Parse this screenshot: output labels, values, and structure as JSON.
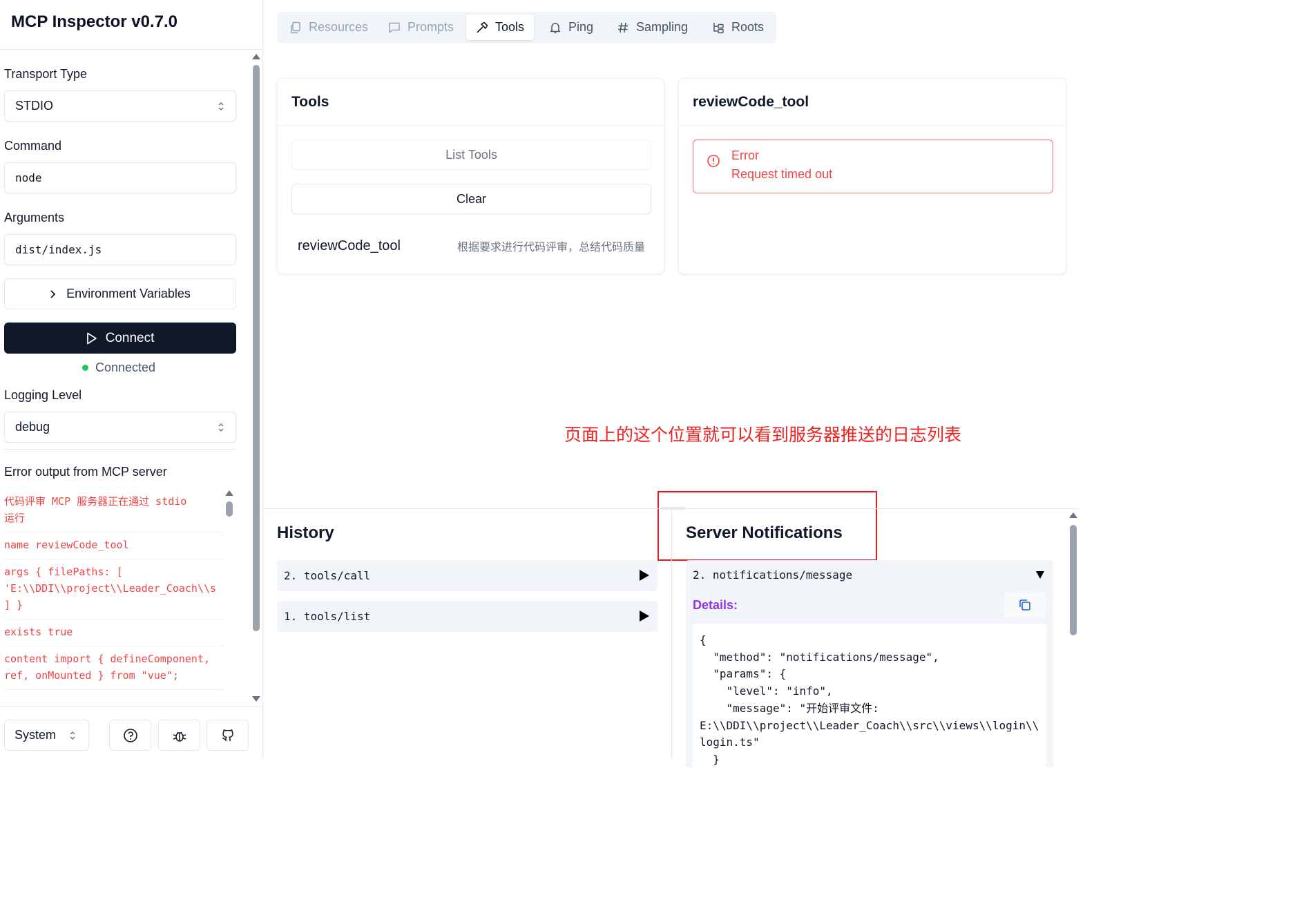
{
  "sidebar": {
    "app_title": "MCP Inspector v0.7.0",
    "transport": {
      "label": "Transport Type",
      "value": "STDIO"
    },
    "command": {
      "label": "Command",
      "value": "node"
    },
    "arguments": {
      "label": "Arguments",
      "value": "dist/index.js"
    },
    "env_button": "Environment Variables",
    "connect_button": "Connect",
    "status": {
      "text": "Connected",
      "color": "#22c55e"
    },
    "logging": {
      "label": "Logging Level",
      "value": "debug"
    },
    "stderr": {
      "title": "Error output from MCP server",
      "lines": [
        "代码评审 MCP 服务器正在通过 stdio\n运行",
        "name reviewCode_tool",
        "args { filePaths: [\n'E:\\\\DDI\\\\project\\\\Leader_Coach\\\\s\n] }",
        "exists true",
        "content import { defineComponent,\nref, onMounted } from \"vue\";"
      ]
    },
    "footer": {
      "theme": "System",
      "icons": [
        "help-icon",
        "bug-icon",
        "github-icon"
      ]
    }
  },
  "tabs": [
    "Resources",
    "Prompts",
    "Tools",
    "Ping",
    "Sampling",
    "Roots"
  ],
  "active_tab": "Tools",
  "tools_panel": {
    "title": "Tools",
    "list_button": "List Tools",
    "clear_button": "Clear",
    "tool": {
      "name": "reviewCode_tool",
      "description": "根据要求进行代码评审，总结代码质量"
    }
  },
  "detail_panel": {
    "title": "reviewCode_tool",
    "error_title": "Error",
    "error_message": "Request timed out",
    "error_color": "#ef4444"
  },
  "annotation": "页面上的这个位置就可以看到服务器推送的日志列表",
  "history": {
    "title": "History",
    "items": [
      "2. tools/call",
      "1. tools/list"
    ]
  },
  "notifications": {
    "title": "Server Notifications",
    "item": "2. notifications/message",
    "details_label": "Details:",
    "details_color": "#9333ea",
    "json": "{\n  \"method\": \"notifications/message\",\n  \"params\": {\n    \"level\": \"info\",\n    \"message\": \"开始评审文件:\nE:\\\\DDI\\\\project\\\\Leader_Coach\\\\src\\\\views\\\\login\\\\\nlogin.ts\"\n  }"
  }
}
